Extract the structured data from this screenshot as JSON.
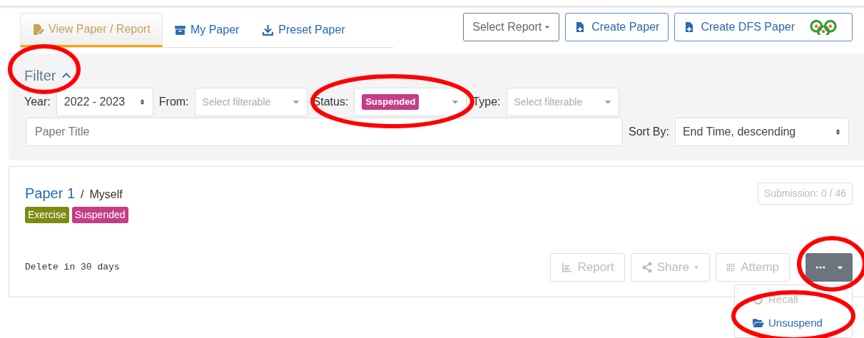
{
  "tabs": [
    {
      "label": "View Paper / Report",
      "kind": "view",
      "selected": true
    },
    {
      "label": "My Paper",
      "kind": "archive",
      "selected": false
    },
    {
      "label": "Preset Paper",
      "kind": "preset",
      "selected": false
    }
  ],
  "header_buttons": [
    {
      "label": "Select Report",
      "kind": "dropdown"
    },
    {
      "label": "Create Paper",
      "kind": "create"
    },
    {
      "label": "Create DFS Paper",
      "kind": "create-dfs"
    }
  ],
  "filter": {
    "title": "Filter",
    "expanded": true,
    "fields": [
      {
        "label": "Year:",
        "kind": "select",
        "value": "2022 - 2023"
      },
      {
        "label": "From:",
        "kind": "combo",
        "placeholder": "Select filterable"
      },
      {
        "label": "Status:",
        "kind": "combo",
        "tag": "Suspended"
      },
      {
        "label": "Type:",
        "kind": "combo",
        "placeholder": "Select filterable"
      }
    ],
    "title_search": {
      "placeholder": "Paper Title"
    },
    "sort": {
      "label": "Sort By:",
      "value": "End Time, descending"
    }
  },
  "papers": [
    {
      "title": "Paper 1",
      "separator": "/",
      "owner": "Myself",
      "tags": [
        {
          "label": "Exercise",
          "color": "#7b8b12"
        },
        {
          "label": "Suspended",
          "color": "#c43d85"
        }
      ],
      "submission": "Submission: 0 / 46",
      "note": "Delete in 30 days",
      "actions": [
        {
          "label": "Report",
          "kind": "report",
          "disabled": true
        },
        {
          "label": "Share",
          "kind": "share",
          "disabled": true
        },
        {
          "label": "Attemp",
          "kind": "attempt",
          "disabled": true
        }
      ],
      "menu": {
        "expanded": true,
        "items": [
          {
            "label": "Recall",
            "kind": "recall",
            "disabled": true
          },
          {
            "label": "Unsuspend",
            "kind": "unsuspend",
            "disabled": false
          }
        ]
      }
    }
  ]
}
